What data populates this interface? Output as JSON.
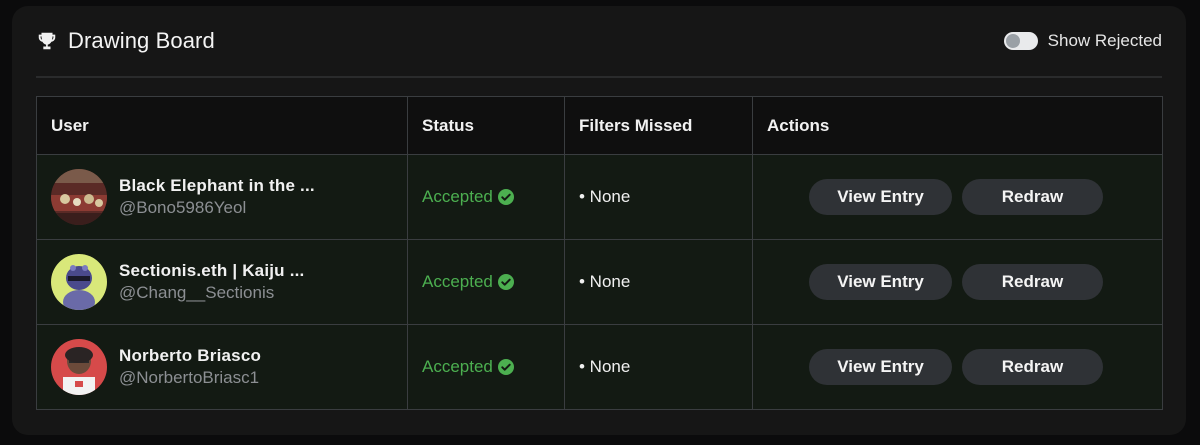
{
  "header": {
    "title": "Drawing Board",
    "trophy_icon": "trophy-icon",
    "toggle_label": "Show Rejected",
    "toggle_on": false
  },
  "table": {
    "columns": [
      "User",
      "Status",
      "Filters Missed",
      "Actions"
    ],
    "rows": [
      {
        "name": "Black Elephant in the ...",
        "handle": "@Bono5986Yeol",
        "status": "Accepted",
        "filters": "• None",
        "view_label": "View Entry",
        "redraw_label": "Redraw"
      },
      {
        "name": "Sectionis.eth | Kaiju ...",
        "handle": "@Chang__Sectionis",
        "status": "Accepted",
        "filters": "• None",
        "view_label": "View Entry",
        "redraw_label": "Redraw"
      },
      {
        "name": "Norberto Briasco",
        "handle": "@NorbertoBriasc1",
        "status": "Accepted",
        "filters": "• None",
        "view_label": "View Entry",
        "redraw_label": "Redraw"
      }
    ]
  },
  "colors": {
    "accepted": "#4caf50",
    "button_bg": "#2f3236",
    "row_bg": "#131a13"
  }
}
